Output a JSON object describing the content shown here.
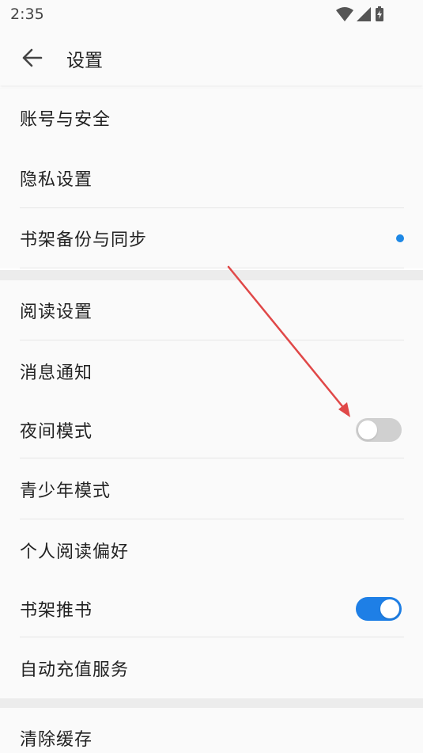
{
  "status_bar": {
    "time": "2:35"
  },
  "header": {
    "title": "设置"
  },
  "section1": [
    {
      "label": "账号与安全"
    },
    {
      "label": "隐私设置"
    },
    {
      "label": "书架备份与同步"
    }
  ],
  "section2": [
    {
      "label": "阅读设置"
    },
    {
      "label": "消息通知"
    },
    {
      "label": "夜间模式",
      "toggle": "off"
    },
    {
      "label": "青少年模式"
    },
    {
      "label": "个人阅读偏好"
    },
    {
      "label": "书架推书",
      "toggle": "on"
    },
    {
      "label": "自动充值服务"
    }
  ],
  "section3": [
    {
      "label": "清除缓存"
    }
  ],
  "colors": {
    "accent": "#1e7fe6",
    "notification_dot": "#1e88e5",
    "annotation_arrow": "#e04848"
  }
}
